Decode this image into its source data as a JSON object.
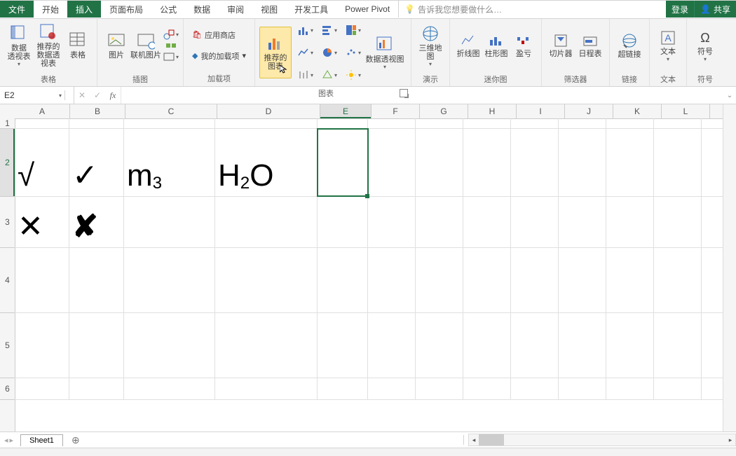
{
  "tabs": {
    "file": "文件",
    "home": "开始",
    "insert": "插入",
    "layout": "页面布局",
    "formulas": "公式",
    "data": "数据",
    "review": "审阅",
    "view": "视图",
    "dev": "开发工具",
    "pivot": "Power Pivot",
    "tell": "告诉我您想要做什么…",
    "login": "登录",
    "share": "共享"
  },
  "ribbon": {
    "tables": {
      "label": "表格",
      "pivotTable": "数据\n透视表",
      "recPivot": "推荐的\n数据透视表",
      "table": "表格"
    },
    "illus": {
      "label": "插图",
      "pic": "图片",
      "online": "联机图片",
      "shapes": "形状",
      "smartart": "SmartArt",
      "screenshot": "屏幕截图"
    },
    "addins": {
      "label": "加载项",
      "store": "应用商店",
      "myaddins": "我的加载项"
    },
    "charts": {
      "label": "图表",
      "rec": "推荐的\n图表",
      "pivotChart": "数据透视图",
      "map3d": "三维地\n图"
    },
    "demo": {
      "label": "演示"
    },
    "spark": {
      "label": "迷你图",
      "line": "折线图",
      "col": "柱形图",
      "winloss": "盈亏"
    },
    "filter": {
      "label": "筛选器",
      "slicer": "切片器",
      "timeline": "日程表"
    },
    "links": {
      "label": "链接",
      "hyper": "超链接"
    },
    "text": {
      "label": "文本",
      "textbox": "文本"
    },
    "symbols": {
      "label": "符号",
      "symbol": "符号"
    }
  },
  "namebox": {
    "ref": "E2"
  },
  "columns": [
    "A",
    "B",
    "C",
    "D",
    "E",
    "F",
    "G",
    "H",
    "I",
    "J",
    "K",
    "L"
  ],
  "rows": [
    "1",
    "2",
    "3",
    "4",
    "5",
    "6"
  ],
  "cells": {
    "A2": "√",
    "B2": "✓",
    "C2": "m³",
    "D2": "H₂O",
    "A3": "✕",
    "B3": "✘"
  },
  "sheetTabs": {
    "sheet1": "Sheet1",
    "add": "⊕"
  }
}
